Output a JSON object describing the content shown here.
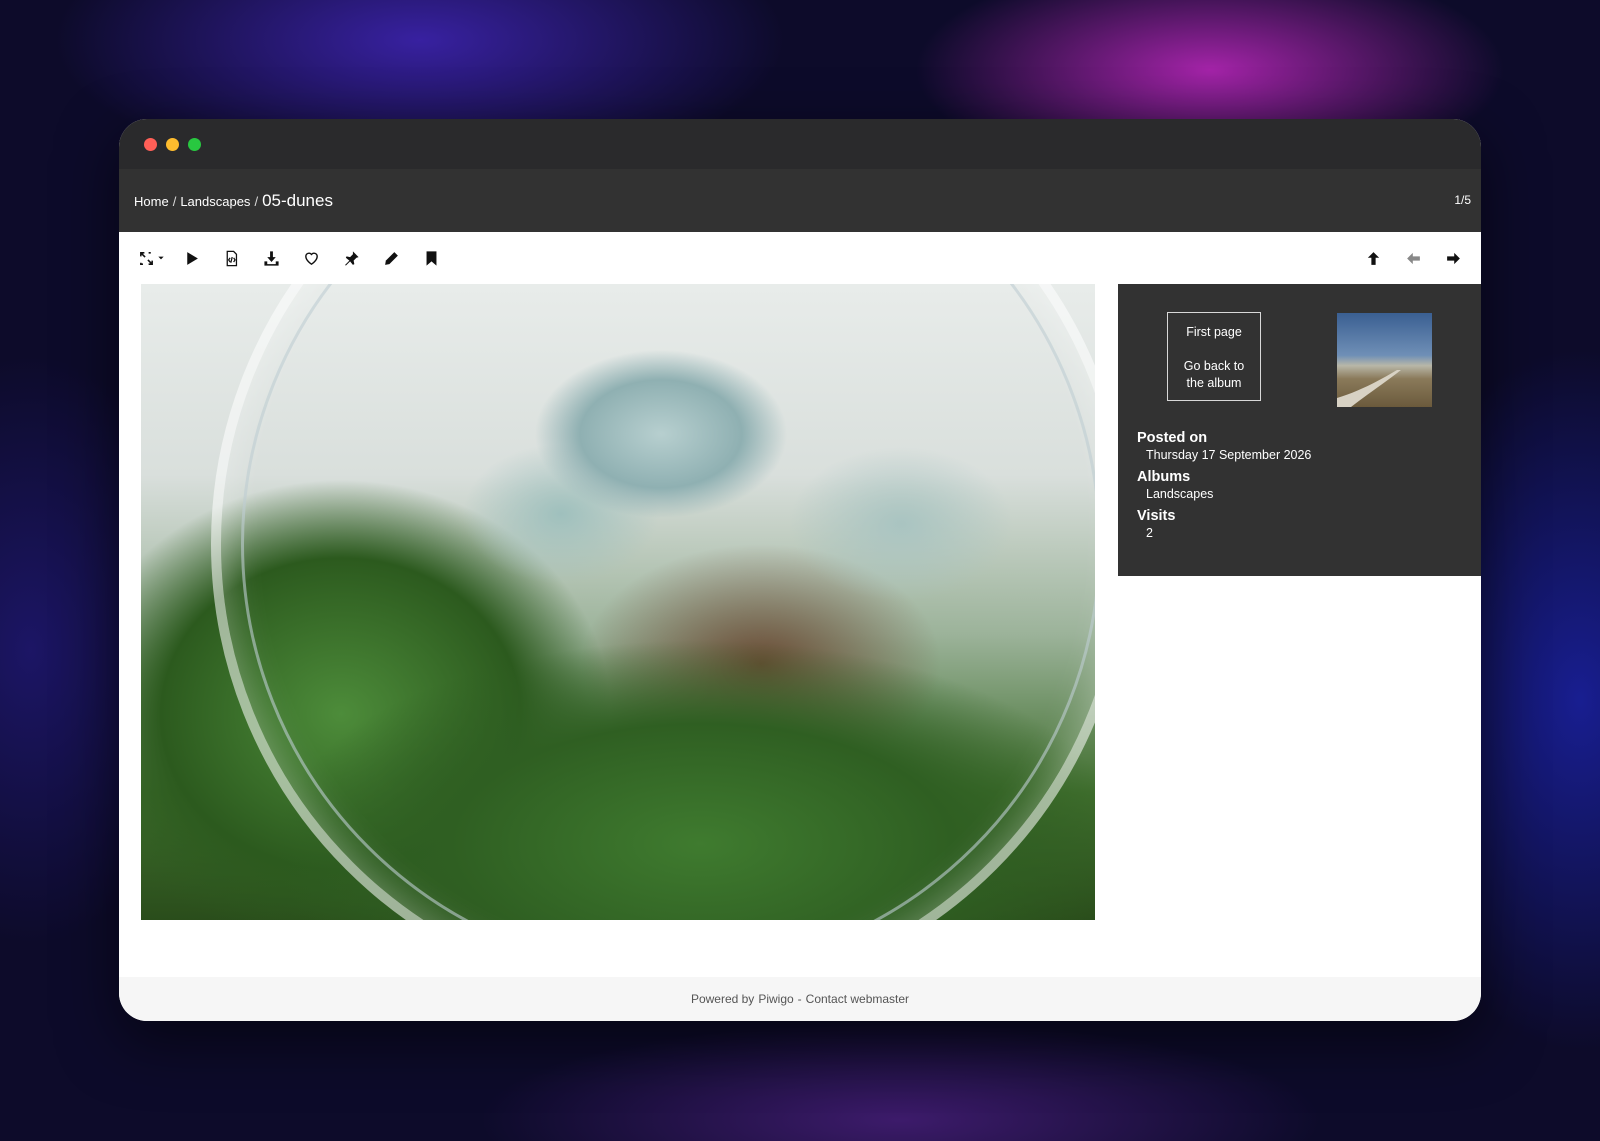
{
  "window": {
    "traffic_lights": [
      "close",
      "minimize",
      "zoom"
    ]
  },
  "breadcrumb": {
    "home": "Home",
    "album": "Landscapes",
    "separator": "/",
    "current": "05-dunes"
  },
  "counter": "1/5",
  "toolbar": {
    "icons": [
      "fullscreen-icon",
      "play-slideshow-icon",
      "embed-code-icon",
      "download-icon",
      "favorite-icon",
      "pin-icon",
      "edit-icon",
      "bookmark-icon"
    ],
    "nav_icons": [
      "up-arrow-icon",
      "previous-arrow-icon",
      "next-arrow-icon"
    ]
  },
  "side": {
    "first_page": "First page",
    "back_line1": "Go back to",
    "back_line2": "the album",
    "posted_label": "Posted on",
    "posted_value": "Thursday 17 September 2026",
    "albums_label": "Albums",
    "albums_value": "Landscapes",
    "visits_label": "Visits",
    "visits_value": "2"
  },
  "footer": {
    "powered": "Powered by",
    "piwigo": "Piwigo",
    "dash": "-",
    "contact": "Contact webmaster"
  }
}
